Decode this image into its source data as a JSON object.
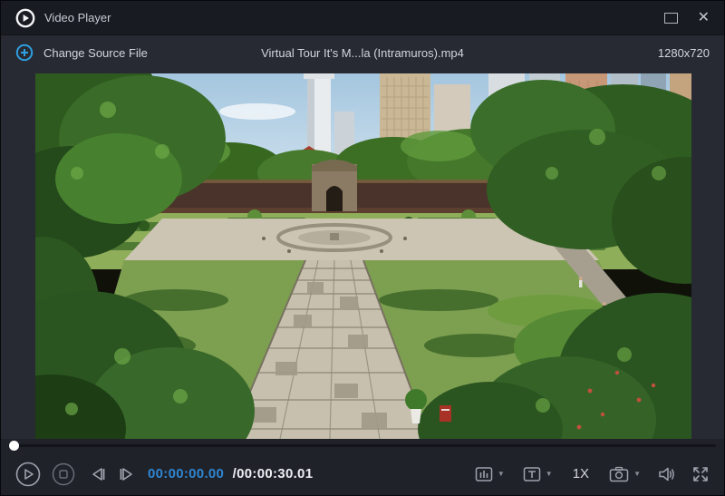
{
  "window": {
    "title": "Video Player"
  },
  "titlebar": {
    "close_glyph": "✕"
  },
  "toolbar": {
    "change_source_label": "Change Source File",
    "filename": "Virtual Tour It's M...la (Intramuros).mp4",
    "resolution": "1280x720"
  },
  "player": {
    "progress_percent": 0,
    "scene_elements": [
      "sky",
      "city-skyline",
      "fort-wall-and-gate",
      "formal-garden",
      "fountain-plaza",
      "central-walkway",
      "flanking-trees",
      "side-path"
    ]
  },
  "controls": {
    "current_time": "00:00:00.00",
    "duration": "/00:00:30.01",
    "speed_label": "1X",
    "subtitle_letter": "T"
  },
  "icons": {
    "caret_glyph": "▼",
    "logo": "play-circle",
    "change_source": "plus-circle",
    "play": "play-outline-circle",
    "stop": "stop-outline-circle",
    "prev_frame": "step-backward",
    "next_frame": "step-forward",
    "audio_tracks": "bars-panel",
    "subtitle": "text-panel",
    "snapshot": "camera",
    "volume": "speaker",
    "fullscreen": "expand-arrows"
  },
  "colors": {
    "accent_blue": "#2e9fe0",
    "time_current": "#2e86d1",
    "titlebar_bg": "#191b22",
    "body_bg": "#272a33",
    "controls_bg": "#20222a"
  }
}
